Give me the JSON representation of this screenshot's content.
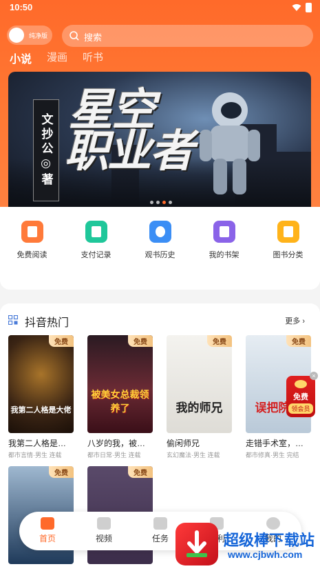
{
  "status": {
    "time": "10:50"
  },
  "top": {
    "toggle_label": "纯净版",
    "search_placeholder": "搜索"
  },
  "tabs": [
    {
      "label": "小说",
      "active": true
    },
    {
      "label": "漫画"
    },
    {
      "label": "听书"
    }
  ],
  "banner": {
    "title_line1": "星空",
    "title_line2": "职业者",
    "author": "文抄公◎著",
    "slides_total": 4,
    "slide_active": 3
  },
  "menu": [
    {
      "label": "免费阅读",
      "icon": "free-read-icon",
      "color": "#ff7a3a"
    },
    {
      "label": "支付记录",
      "icon": "payment-record-icon",
      "color": "#1fc79a"
    },
    {
      "label": "观书历史",
      "icon": "history-clock-icon",
      "color": "#3b8ef5"
    },
    {
      "label": "我的书架",
      "icon": "bookshelf-icon",
      "color": "#8a63e8"
    },
    {
      "label": "图书分类",
      "icon": "book-category-icon",
      "color": "#ffb31a"
    }
  ],
  "section": {
    "title": "抖音热门",
    "more": "更多",
    "books": [
      {
        "title": "我第二人格是…",
        "meta": "都市言情·男生 连载",
        "tag": "免费",
        "cover_text": "我第二人格是大佬",
        "cover_color": "#3a2414"
      },
      {
        "title": "八岁的我，被…",
        "meta": "都市日常·男生 连载",
        "tag": "免费",
        "cover_text": "被美女总裁领养了",
        "cover_color": "#5a1a24"
      },
      {
        "title": "偷闲师兄",
        "meta": "玄幻魔法·男生 连载",
        "tag": "免费",
        "cover_text": "我的师兄",
        "cover_color": "#e8e8e4"
      },
      {
        "title": "走错手术室，…",
        "meta": "都市修真·男生 完结",
        "tag": "免费",
        "cover_text": "误把院长",
        "cover_color": "#cfdbe6"
      }
    ],
    "books_row2": [
      {
        "tag": "免费",
        "cover_color": "#1f3a5a"
      },
      {
        "tag": "免费",
        "cover_color": "#3c2d4a"
      }
    ]
  },
  "vip": {
    "line1": "免费",
    "line2": "领会员"
  },
  "nav": [
    {
      "label": "首页",
      "icon": "home-book-icon",
      "active": true
    },
    {
      "label": "视频",
      "icon": "video-icon"
    },
    {
      "label": "任务",
      "icon": "gift-icon"
    },
    {
      "label": "福利",
      "icon": "welfare-icon"
    },
    {
      "label": "我的",
      "icon": "profile-icon"
    }
  ],
  "watermark": {
    "name": "超级棒下载站",
    "url": "www.cjbwh.com"
  }
}
